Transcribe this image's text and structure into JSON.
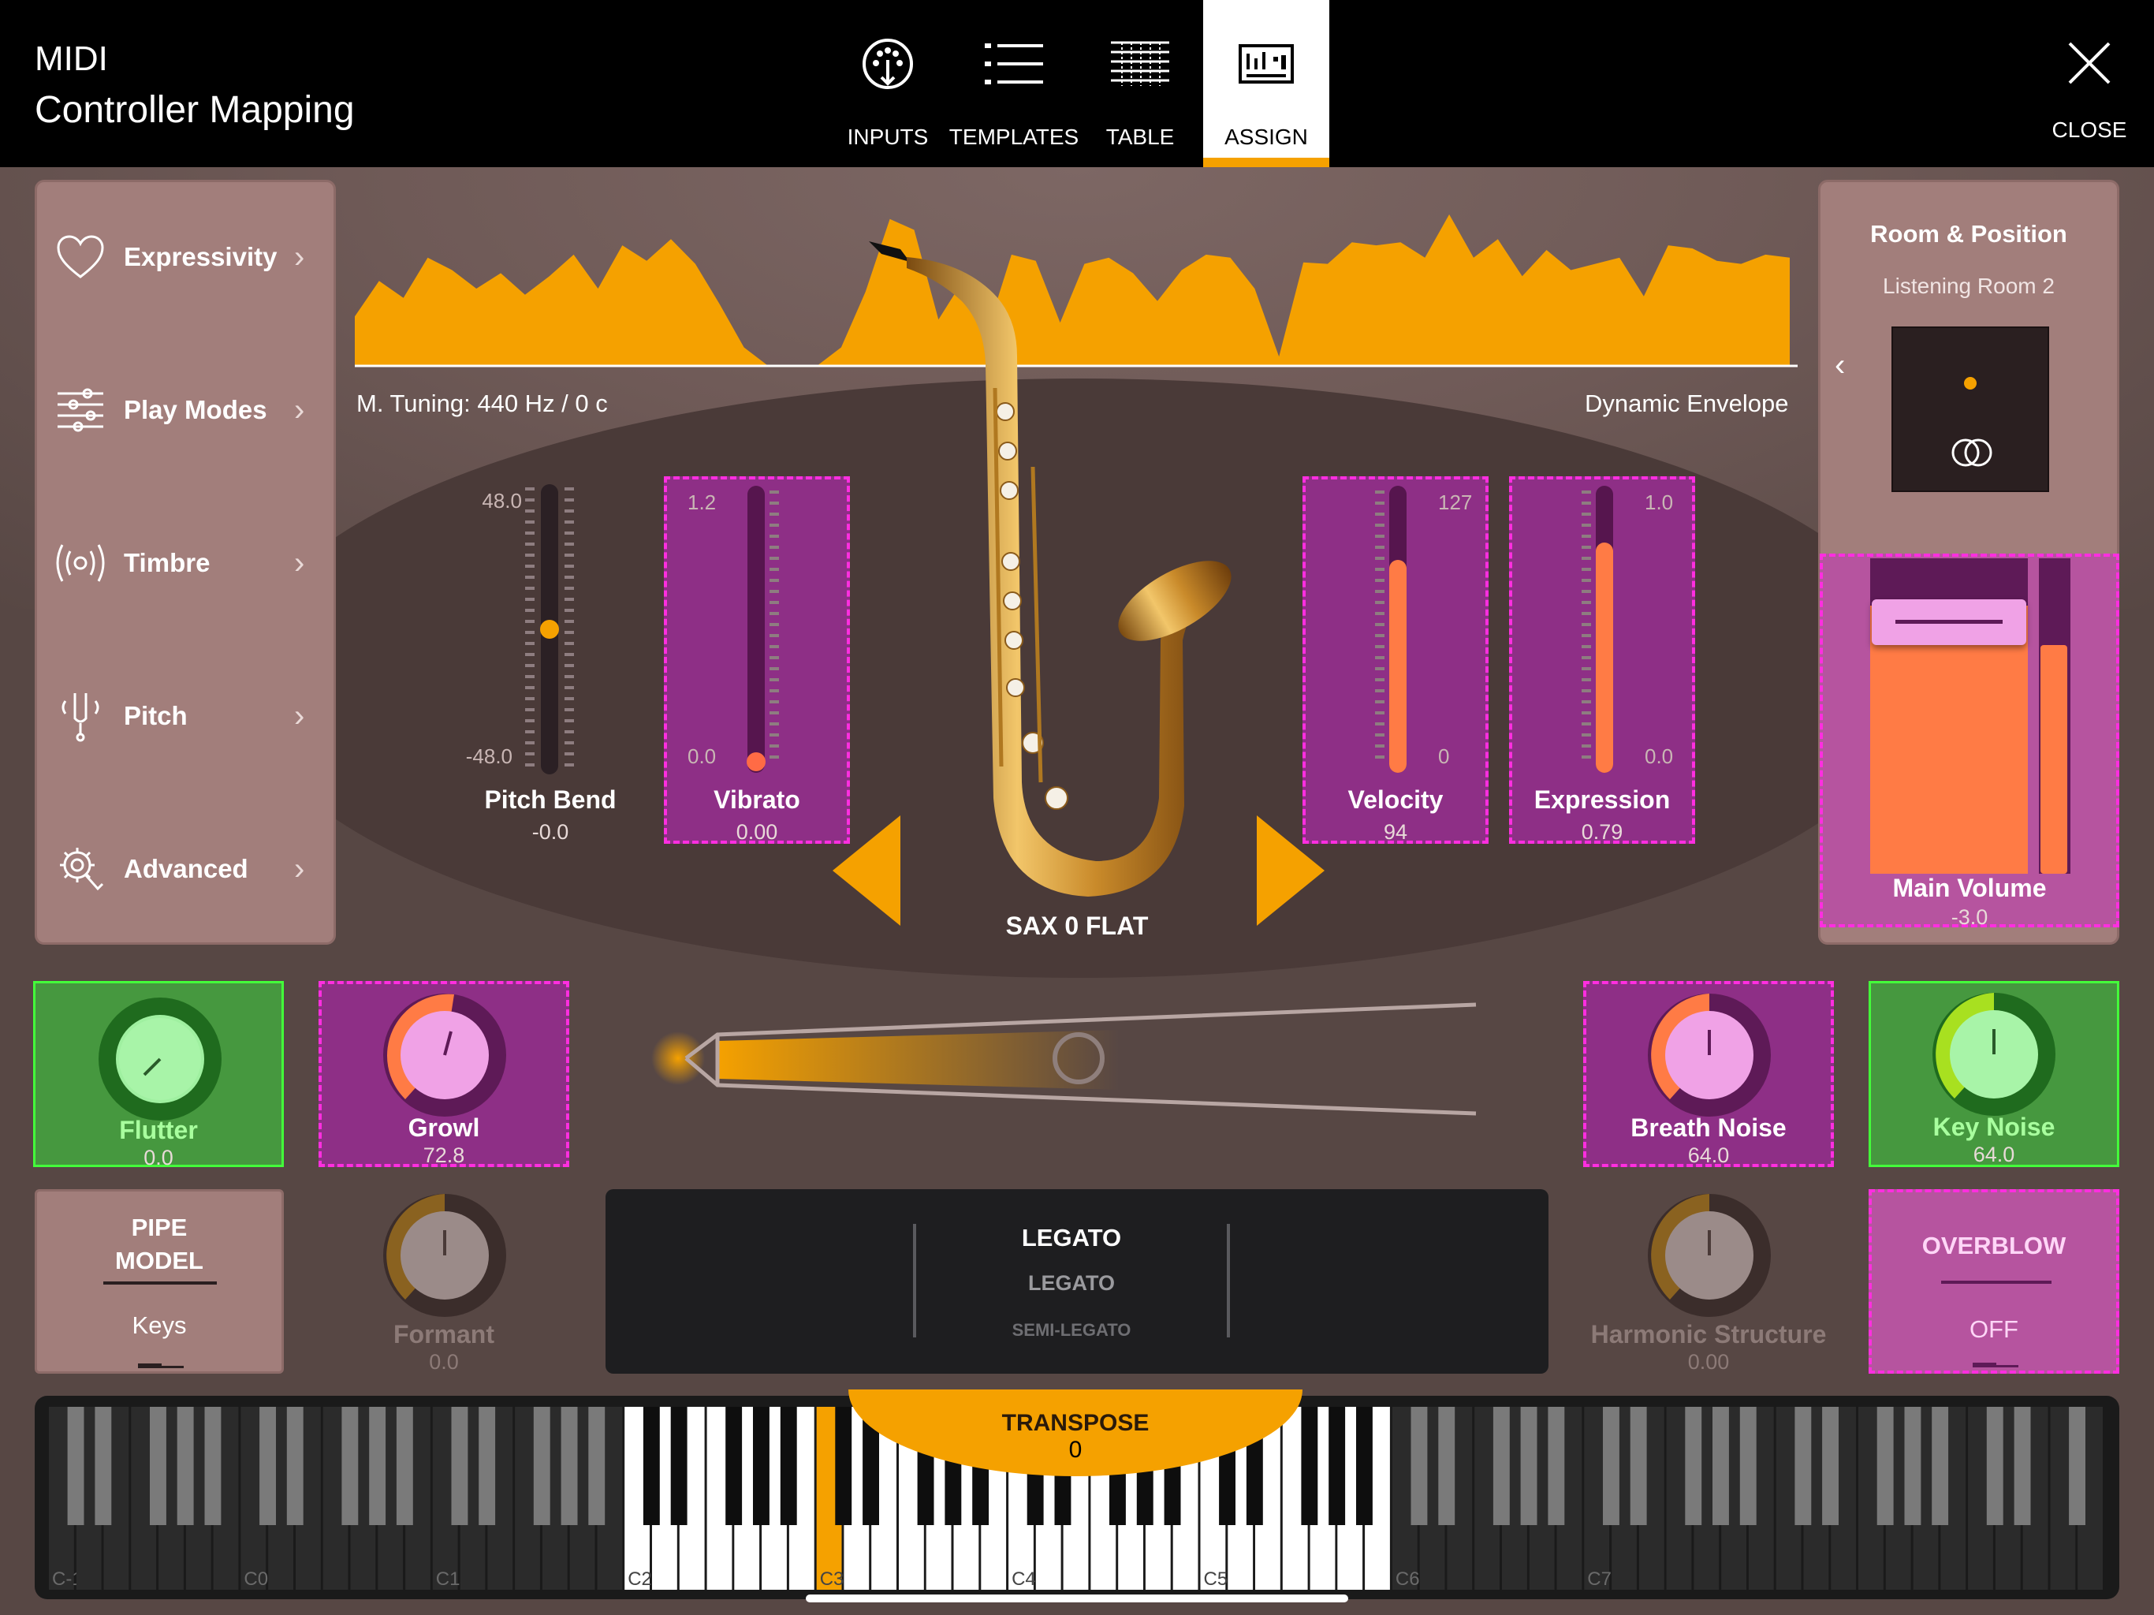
{
  "app": {
    "title_line1": "MIDI",
    "title_line2": "Controller Mapping"
  },
  "tabs": [
    {
      "label": "INPUTS",
      "icon": "midi-port-icon"
    },
    {
      "label": "TEMPLATES",
      "icon": "list-icon"
    },
    {
      "label": "TABLE",
      "icon": "table-icon"
    },
    {
      "label": "ASSIGN",
      "icon": "assign-icon",
      "active": true
    }
  ],
  "close": {
    "label": "CLOSE"
  },
  "menu": [
    {
      "label": "Expressivity",
      "icon": "heart-icon"
    },
    {
      "label": "Play Modes",
      "icon": "sliders-icon"
    },
    {
      "label": "Timbre",
      "icon": "radio-waves-icon"
    },
    {
      "label": "Pitch",
      "icon": "tuning-fork-icon"
    },
    {
      "label": "Advanced",
      "icon": "gear-touch-icon"
    }
  ],
  "envelope": {
    "tuning": "M. Tuning: 440 Hz / 0 c",
    "label": "Dynamic Envelope",
    "color": "#f5a100",
    "values": [
      0.32,
      0.55,
      0.44,
      0.7,
      0.62,
      0.5,
      0.6,
      0.46,
      0.58,
      0.72,
      0.5,
      0.78,
      0.68,
      0.82,
      0.66,
      0.4,
      0.12,
      0,
      0,
      0,
      0.12,
      0.48,
      0.95,
      0.88,
      0.3,
      0.55,
      0.22,
      0.72,
      0.68,
      0.28,
      0.66,
      0.7,
      0.6,
      0.42,
      0.62,
      0.72,
      0.7,
      0.5,
      0.06,
      0.67,
      0.66,
      0.8,
      0.78,
      0.8,
      0.7,
      0.98,
      0.7,
      0.82,
      0.58,
      0.75,
      0.62,
      0.66,
      0.7,
      0.45,
      0.78,
      0.76,
      0.68,
      0.66,
      0.72,
      0.7
    ]
  },
  "sliders": {
    "pitch_bend": {
      "name": "Pitch Bend",
      "value": "-0.0",
      "max": "48.0",
      "min": "-48.0",
      "level": 0.5
    },
    "vibrato": {
      "name": "Vibrato",
      "value": "0.00",
      "max": "1.2",
      "min": "0.0",
      "level": 0.0
    },
    "velocity": {
      "name": "Velocity",
      "value": "94",
      "max": "127",
      "min": "0",
      "level": 0.74
    },
    "expression": {
      "name": "Expression",
      "value": "0.79",
      "max": "1.0",
      "min": "0.0",
      "level": 0.79
    }
  },
  "instrument": {
    "name": "SAX 0 FLAT"
  },
  "room": {
    "title": "Room & Position",
    "subtitle": "Listening Room 2"
  },
  "main_volume": {
    "name": "Main Volume",
    "value": "-3.0",
    "level": 0.84
  },
  "knobs": {
    "flutter": {
      "name": "Flutter",
      "value": "0.0",
      "level": 0.0
    },
    "growl": {
      "name": "Growl",
      "value": "72.8",
      "level": 0.57
    },
    "breath_noise": {
      "name": "Breath Noise",
      "value": "64.0",
      "level": 0.5
    },
    "key_noise": {
      "name": "Key Noise",
      "value": "64.0",
      "level": 0.5
    },
    "formant": {
      "name": "Formant",
      "value": "0.0",
      "level": 0.5
    },
    "harmonic_structure": {
      "name": "Harmonic Structure",
      "value": "0.00",
      "level": 0.5
    }
  },
  "pipe_model": {
    "line1": "PIPE",
    "line2": "MODEL",
    "value": "Keys"
  },
  "overblow": {
    "label": "OVERBLOW",
    "value": "OFF"
  },
  "legato": {
    "selected": "LEGATO",
    "options": [
      "LEGATO",
      "SEMI-LEGATO"
    ]
  },
  "transpose": {
    "label": "TRANSPOSE",
    "value": "0"
  },
  "keyboard": {
    "octave_labels": [
      "C-1",
      "C0",
      "C1",
      "C2",
      "C3",
      "C4",
      "C5",
      "C6",
      "C7"
    ],
    "active_octaves": [
      "C2",
      "C3",
      "C4",
      "C5"
    ],
    "highlighted_key": "C3"
  },
  "colors": {
    "accent": "#f5a100",
    "assigned": "#ff2ee0",
    "green": "#43ff3a",
    "fill": "#ff7b45"
  }
}
